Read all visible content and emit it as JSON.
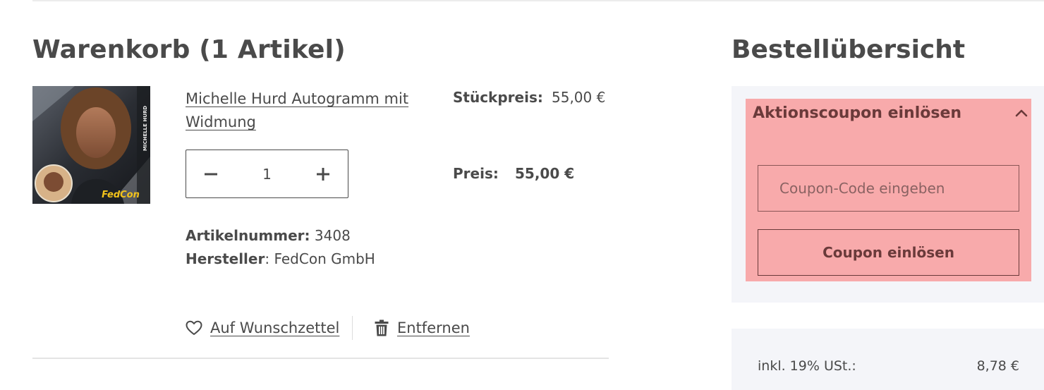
{
  "cart": {
    "title": "Warenkorb (1 Artikel)",
    "item": {
      "name": "Michelle Hurd Autogramm mit Widmung",
      "image_caption": "MICHELLE HURD",
      "image_logo": "FedCon",
      "unit_price_label": "Stückpreis:",
      "unit_price": "55,00 €",
      "quantity": "1",
      "price_label": "Preis:",
      "price": "55,00 €",
      "article_number_label": "Artikelnummer:",
      "article_number": "3408",
      "manufacturer_label": "Hersteller",
      "manufacturer": "FedCon GmbH",
      "wishlist_label": "Auf Wunschzettel",
      "remove_label": "Entfernen"
    }
  },
  "summary": {
    "title": "Bestellübersicht",
    "coupon": {
      "header": "Aktionscoupon einlösen",
      "placeholder": "Coupon-Code eingeben",
      "button_label": "Coupon einlösen"
    },
    "tax": {
      "label": "inkl. 19% USt.:",
      "value": "8,78 €"
    }
  },
  "icons": {
    "minus": "minus-icon",
    "plus": "plus-icon",
    "wishlist": "heart-icon",
    "remove": "trash-icon",
    "collapse": "chevron-up-icon"
  },
  "colors": {
    "text": "#4a4a4a",
    "panel_bg": "#f4f5f9",
    "coupon_highlight": "#f8aaab"
  }
}
